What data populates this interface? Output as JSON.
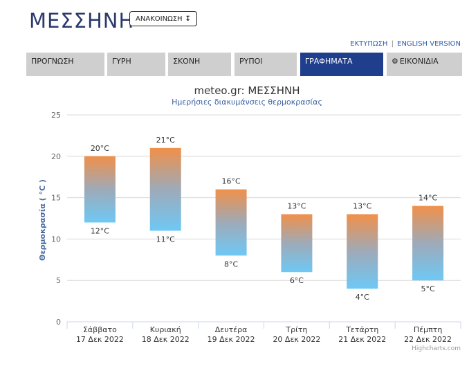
{
  "header": {
    "title": "ΜΕΣΣΗΝΗ",
    "announce_label": "ΑΝΑΚΟΙΝΩΣΗ",
    "announce_arrow": "↧",
    "link_print": "ΕΚΤΥΠΩΣΗ",
    "link_sep": "|",
    "link_english": "ENGLISH VERSION"
  },
  "tabs": [
    {
      "label": "ΠΡΟΓΝΩΣΗ"
    },
    {
      "label": "ΓΥΡΗ"
    },
    {
      "label": "ΣΚΟΝΗ"
    },
    {
      "label": "ΡΥΠΟΙ"
    },
    {
      "label": "ΓΡΑΦΗΜΑΤΑ",
      "active": true
    },
    {
      "label": "ΕΙΚΟΝΙΔΙΑ",
      "icon": "gear-icon"
    }
  ],
  "credits": "Highcharts.com",
  "colors": {
    "bar_top": "#f0904a",
    "bar_mid": "#9eaab8",
    "bar_bottom": "#6ec8f5",
    "active_tab": "#1f3e8c",
    "title": "#2b3a6b"
  },
  "chart_data": {
    "type": "columnrange",
    "title": "meteo.gr: ΜΕΣΣΗΝΗ",
    "subtitle": "Ημερήσιες διακυμάνσεις θερμοκρασίας",
    "ylabel": "Θερμοκρασία ( °C )",
    "ylim": [
      0,
      25
    ],
    "yticks": [
      0,
      5,
      10,
      15,
      20,
      25
    ],
    "categories": [
      {
        "day": "Σάββατο",
        "date": "17 Δεκ 2022"
      },
      {
        "day": "Κυριακή",
        "date": "18 Δεκ 2022"
      },
      {
        "day": "Δευτέρα",
        "date": "19 Δεκ 2022"
      },
      {
        "day": "Τρίτη",
        "date": "20 Δεκ 2022"
      },
      {
        "day": "Τετάρτη",
        "date": "21 Δεκ 2022"
      },
      {
        "day": "Πέμπτη",
        "date": "22 Δεκ 2022"
      }
    ],
    "low": [
      12,
      11,
      8,
      6,
      4,
      5
    ],
    "high": [
      20,
      21,
      16,
      13,
      13,
      14
    ],
    "unit": "°C",
    "grid": true
  }
}
